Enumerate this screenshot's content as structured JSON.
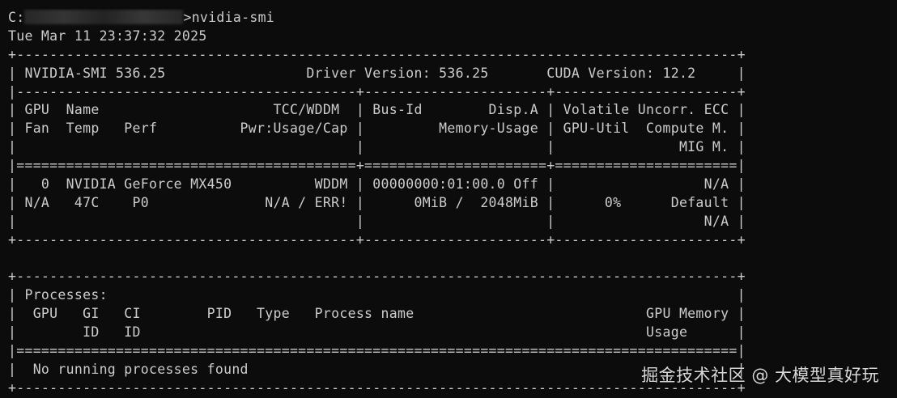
{
  "terminal": {
    "prompt_prefix": "C:",
    "prompt_suffix": ">",
    "command": "nvidia-smi",
    "timestamp": "Tue Mar 11 23:37:32 2025",
    "output_lines": [
      "+---------------------------------------------------------------------------------------+",
      "| NVIDIA-SMI 536.25                 Driver Version: 536.25       CUDA Version: 12.2     |",
      "|-----------------------------------------+----------------------+----------------------+",
      "| GPU  Name                     TCC/WDDM  | Bus-Id        Disp.A | Volatile Uncorr. ECC |",
      "| Fan  Temp   Perf          Pwr:Usage/Cap |         Memory-Usage | GPU-Util  Compute M. |",
      "|                                         |                      |               MIG M. |",
      "|=========================================+======================+======================|",
      "|   0  NVIDIA GeForce MX450          WDDM | 00000000:01:00.0 Off |                  N/A |",
      "| N/A   47C    P0              N/A / ERR! |      0MiB /  2048MiB |      0%      Default |",
      "|                                         |                      |                  N/A |",
      "+-----------------------------------------+----------------------+----------------------+",
      "",
      "+---------------------------------------------------------------------------------------+",
      "| Processes:                                                                            |",
      "|  GPU   GI   CI        PID   Type   Process name                            GPU Memory |",
      "|        ID   ID                                                             Usage      |",
      "|=======================================================================================|",
      "|  No running processes found                                                           |",
      "+---------------------------------------------------------------------------------------+"
    ]
  },
  "watermark": {
    "text": "掘金技术社区 @ 大模型真好玩"
  },
  "colors": {
    "background": "#0c0c0c",
    "foreground": "#cccccc"
  }
}
